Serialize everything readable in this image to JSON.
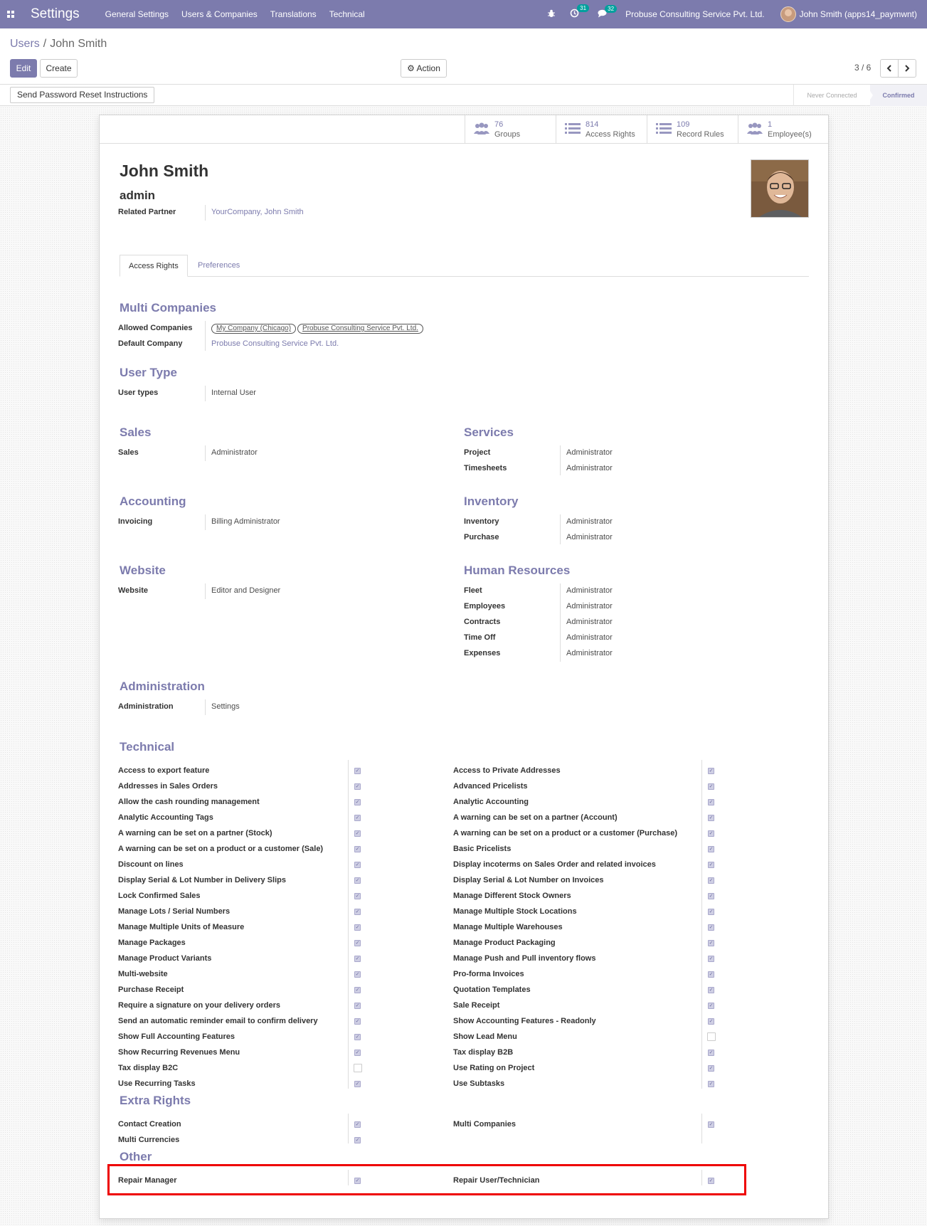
{
  "navbar": {
    "app_title": "Settings",
    "menus": [
      "General Settings",
      "Users & Companies",
      "Translations",
      "Technical"
    ],
    "activity_count": "31",
    "message_count": "32",
    "company": "Probuse Consulting Service Pvt. Ltd.",
    "user": "John Smith (apps14_paymwnt)"
  },
  "breadcrumb": {
    "parent": "Users",
    "separator": "/",
    "current": "John Smith"
  },
  "buttons": {
    "edit": "Edit",
    "create": "Create",
    "action": "Action"
  },
  "pager": {
    "value": "3 / 6"
  },
  "statusbar": {
    "reset_button": "Send Password Reset Instructions",
    "stages": [
      "Never Connected",
      "Confirmed"
    ]
  },
  "stats": [
    {
      "value": "76",
      "label": "Groups",
      "icon": "users-icon"
    },
    {
      "value": "814",
      "label": "Access Rights",
      "icon": "list-icon"
    },
    {
      "value": "109",
      "label": "Record Rules",
      "icon": "list-icon"
    },
    {
      "value": "1",
      "label": "Employee(s)",
      "icon": "users-icon"
    }
  ],
  "user": {
    "name": "John Smith",
    "login": "admin"
  },
  "related_partner": {
    "label": "Related Partner",
    "value": "YourCompany, John Smith"
  },
  "tabs": [
    "Access Rights",
    "Preferences"
  ],
  "multi_companies": {
    "title": "Multi Companies",
    "allowed_label": "Allowed Companies",
    "allowed": [
      "My Company (Chicago)",
      "Probuse Consulting Service Pvt. Ltd."
    ],
    "default_label": "Default Company",
    "default_value": "Probuse Consulting Service Pvt. Ltd."
  },
  "user_type": {
    "title": "User Type",
    "label": "User types",
    "value": "Internal User"
  },
  "sales": {
    "title": "Sales",
    "fields": [
      {
        "label": "Sales",
        "value": "Administrator"
      }
    ]
  },
  "services": {
    "title": "Services",
    "fields": [
      {
        "label": "Project",
        "value": "Administrator"
      },
      {
        "label": "Timesheets",
        "value": "Administrator"
      }
    ]
  },
  "accounting": {
    "title": "Accounting",
    "fields": [
      {
        "label": "Invoicing",
        "value": "Billing Administrator"
      }
    ]
  },
  "inventory": {
    "title": "Inventory",
    "fields": [
      {
        "label": "Inventory",
        "value": "Administrator"
      },
      {
        "label": "Purchase",
        "value": "Administrator"
      }
    ]
  },
  "website": {
    "title": "Website",
    "fields": [
      {
        "label": "Website",
        "value": "Editor and Designer"
      }
    ]
  },
  "human_resources": {
    "title": "Human Resources",
    "fields": [
      {
        "label": "Fleet",
        "value": "Administrator"
      },
      {
        "label": "Employees",
        "value": "Administrator"
      },
      {
        "label": "Contracts",
        "value": "Administrator"
      },
      {
        "label": "Time Off",
        "value": "Administrator"
      },
      {
        "label": "Expenses",
        "value": "Administrator"
      }
    ]
  },
  "administration": {
    "title": "Administration",
    "fields": [
      {
        "label": "Administration",
        "value": "Settings"
      }
    ]
  },
  "technical": {
    "title": "Technical",
    "left": [
      {
        "label": "Access to export feature",
        "checked": true
      },
      {
        "label": "Addresses in Sales Orders",
        "checked": true
      },
      {
        "label": "Allow the cash rounding management",
        "checked": true
      },
      {
        "label": "Analytic Accounting Tags",
        "checked": true
      },
      {
        "label": "A warning can be set on a partner (Stock)",
        "checked": true
      },
      {
        "label": "A warning can be set on a product or a customer (Sale)",
        "checked": true
      },
      {
        "label": "Discount on lines",
        "checked": true
      },
      {
        "label": "Display Serial & Lot Number in Delivery Slips",
        "checked": true
      },
      {
        "label": "Lock Confirmed Sales",
        "checked": true
      },
      {
        "label": "Manage Lots / Serial Numbers",
        "checked": true
      },
      {
        "label": "Manage Multiple Units of Measure",
        "checked": true
      },
      {
        "label": "Manage Packages",
        "checked": true
      },
      {
        "label": "Manage Product Variants",
        "checked": true
      },
      {
        "label": "Multi-website",
        "checked": true
      },
      {
        "label": "Purchase Receipt",
        "checked": true
      },
      {
        "label": "Require a signature on your delivery orders",
        "checked": true
      },
      {
        "label": "Send an automatic reminder email to confirm delivery",
        "checked": true
      },
      {
        "label": "Show Full Accounting Features",
        "checked": true
      },
      {
        "label": "Show Recurring Revenues Menu",
        "checked": true
      },
      {
        "label": "Tax display B2C",
        "checked": false
      },
      {
        "label": "Use Recurring Tasks",
        "checked": true
      }
    ],
    "right": [
      {
        "label": "Access to Private Addresses",
        "checked": true
      },
      {
        "label": "Advanced Pricelists",
        "checked": true
      },
      {
        "label": "Analytic Accounting",
        "checked": true
      },
      {
        "label": "A warning can be set on a partner (Account)",
        "checked": true
      },
      {
        "label": "A warning can be set on a product or a customer (Purchase)",
        "checked": true
      },
      {
        "label": "Basic Pricelists",
        "checked": true
      },
      {
        "label": "Display incoterms on Sales Order and related invoices",
        "checked": true
      },
      {
        "label": "Display Serial & Lot Number on Invoices",
        "checked": true
      },
      {
        "label": "Manage Different Stock Owners",
        "checked": true
      },
      {
        "label": "Manage Multiple Stock Locations",
        "checked": true
      },
      {
        "label": "Manage Multiple Warehouses",
        "checked": true
      },
      {
        "label": "Manage Product Packaging",
        "checked": true
      },
      {
        "label": "Manage Push and Pull inventory flows",
        "checked": true
      },
      {
        "label": "Pro-forma Invoices",
        "checked": true
      },
      {
        "label": "Quotation Templates",
        "checked": true
      },
      {
        "label": "Sale Receipt",
        "checked": true
      },
      {
        "label": "Show Accounting Features - Readonly",
        "checked": true
      },
      {
        "label": "Show Lead Menu",
        "checked": false
      },
      {
        "label": "Tax display B2B",
        "checked": true
      },
      {
        "label": "Use Rating on Project",
        "checked": true
      },
      {
        "label": "Use Subtasks",
        "checked": true
      }
    ]
  },
  "extra_rights": {
    "title": "Extra Rights",
    "left": [
      {
        "label": "Contact Creation",
        "checked": true
      },
      {
        "label": "Multi Currencies",
        "checked": true
      }
    ],
    "right": [
      {
        "label": "Multi Companies",
        "checked": true
      }
    ]
  },
  "other": {
    "title": "Other",
    "left": [
      {
        "label": "Repair Manager",
        "checked": true
      }
    ],
    "right": [
      {
        "label": "Repair User/Technician",
        "checked": true
      }
    ]
  },
  "colors": {
    "brand": "#7c7bad",
    "highlight": "#ee0000"
  }
}
